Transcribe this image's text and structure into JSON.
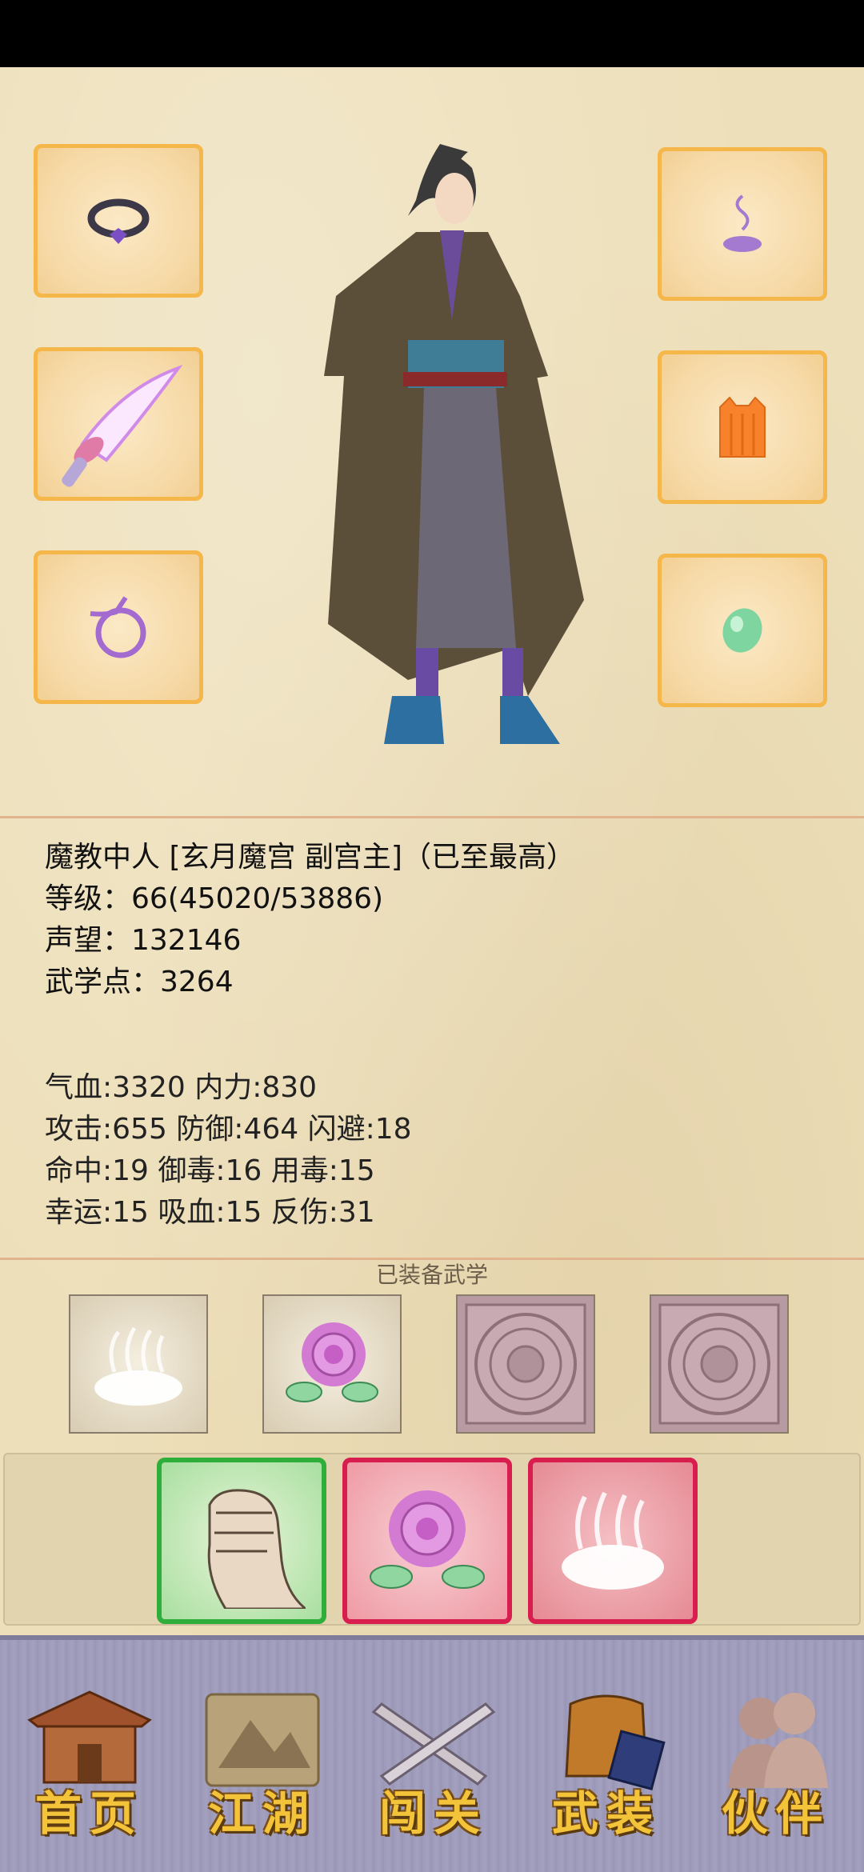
{
  "character": {
    "title_line": "魔教中人 [玄月魔宫 副宫主]（已至最高）",
    "level_line": "等级：66(45020/53886)",
    "reputation_line": "声望：132146",
    "martial_points_line": "武学点：3264"
  },
  "stats": {
    "line1": "气血:3320  内力:830",
    "line2": "攻击:655  防御:464  闪避:18",
    "line3": "命中:19  御毒:16  用毒:15",
    "line4": "幸运:15  吸血:15  反伤:31"
  },
  "equipped": {
    "title": "已装备武学"
  },
  "nav": {
    "home": "首页",
    "jianghu": "江湖",
    "challenge": "闯关",
    "equipment": "武装",
    "partner": "伙伴"
  },
  "colors": {
    "slot_border": "#f5b64a",
    "active_green": "#2fae3c",
    "active_red": "#d81e4e",
    "nav_label": "#f3c33a"
  }
}
